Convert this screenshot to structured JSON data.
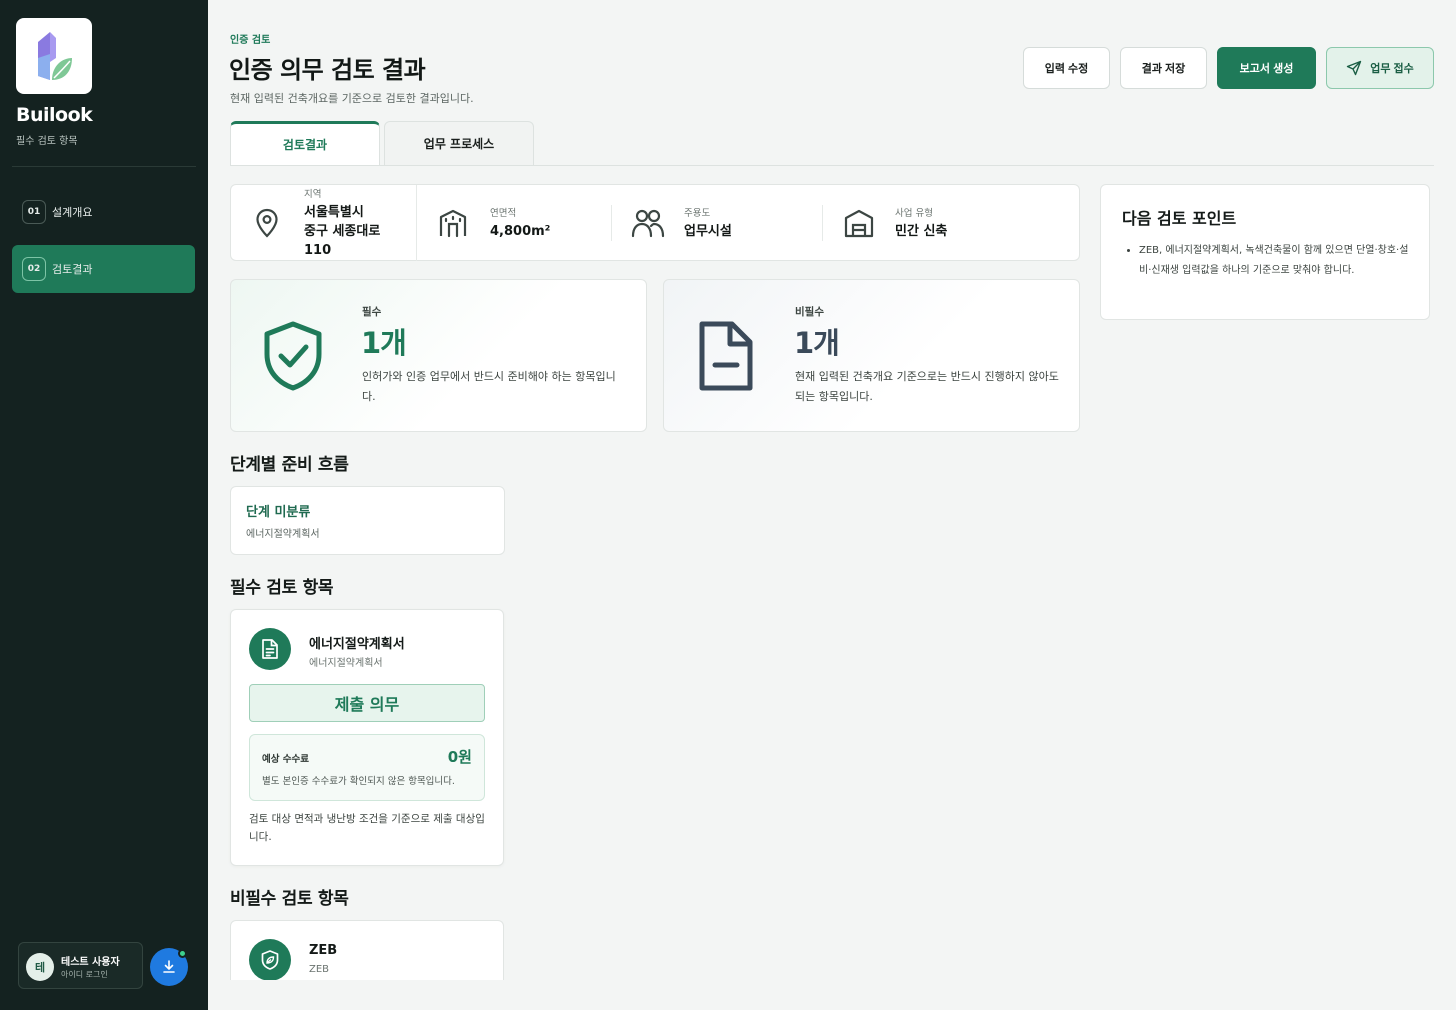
{
  "sidebar": {
    "brand": "Builook",
    "subtitle": "필수 검토 항목",
    "items": [
      {
        "num": "01",
        "label": "설계개요"
      },
      {
        "num": "02",
        "label": "검토결과"
      }
    ],
    "user": {
      "initial": "테",
      "name": "테스트 사용자",
      "status": "아이디 로그인"
    }
  },
  "header": {
    "eyebrow": "인증 검토",
    "title": "인증 의무 검토 결과",
    "description": "현재 입력된 건축개요를 기준으로 검토한 결과입니다.",
    "buttons": {
      "edit": "입력 수정",
      "save": "결과 저장",
      "report": "보고서 생성",
      "submit": "업무 접수"
    }
  },
  "tabs": [
    "검토결과",
    "업무 프로세스"
  ],
  "info": {
    "region": {
      "label": "지역",
      "value_lines": [
        "서울특별시",
        "중구 세종대로",
        "110"
      ]
    },
    "area": {
      "label": "연면적",
      "value": "4,800m²"
    },
    "use": {
      "label": "주용도",
      "value": "업무시설"
    },
    "type": {
      "label": "사업 유형",
      "value": "민간 신축"
    }
  },
  "summary": {
    "required": {
      "label": "필수",
      "count": "1개",
      "desc": "인허가와 인증 업무에서 반드시 준비해야 하는 항목입니다."
    },
    "optional": {
      "label": "비필수",
      "count": "1개",
      "desc": "현재 입력된 건축개요 기준으로는 반드시 진행하지 않아도 되는 항목입니다."
    }
  },
  "next_review": {
    "title": "다음 검토 포인트",
    "items": [
      "ZEB, 에너지절약계획서, 녹색건축물이 함께 있으면 단열·창호·설비·신재생 입력값을 하나의 기준으로 맞춰야 합니다."
    ]
  },
  "stages": {
    "title": "단계별 준비 흐름",
    "card": {
      "title": "단계 미분류",
      "sub": "에너지절약계획서"
    }
  },
  "required_items": {
    "title": "필수 검토 항목",
    "item": {
      "name": "에너지절약계획서",
      "sub": "에너지절약계획서",
      "obligation": "제출 의무",
      "fee_label": "예상 수수료",
      "fee_value": "0원",
      "fee_note": "별도 본인증 수수료가 확인되지 않은 항목입니다.",
      "desc": "검토 대상 면적과 냉난방 조건을 기준으로 제출 대상입니다."
    }
  },
  "optional_items": {
    "title": "비필수 검토 항목",
    "item": {
      "name": "ZEB",
      "sub": "ZEB"
    }
  },
  "colors": {
    "accent": "#1f7a59",
    "sidebar": "#142220",
    "background": "#f3f5f4"
  }
}
